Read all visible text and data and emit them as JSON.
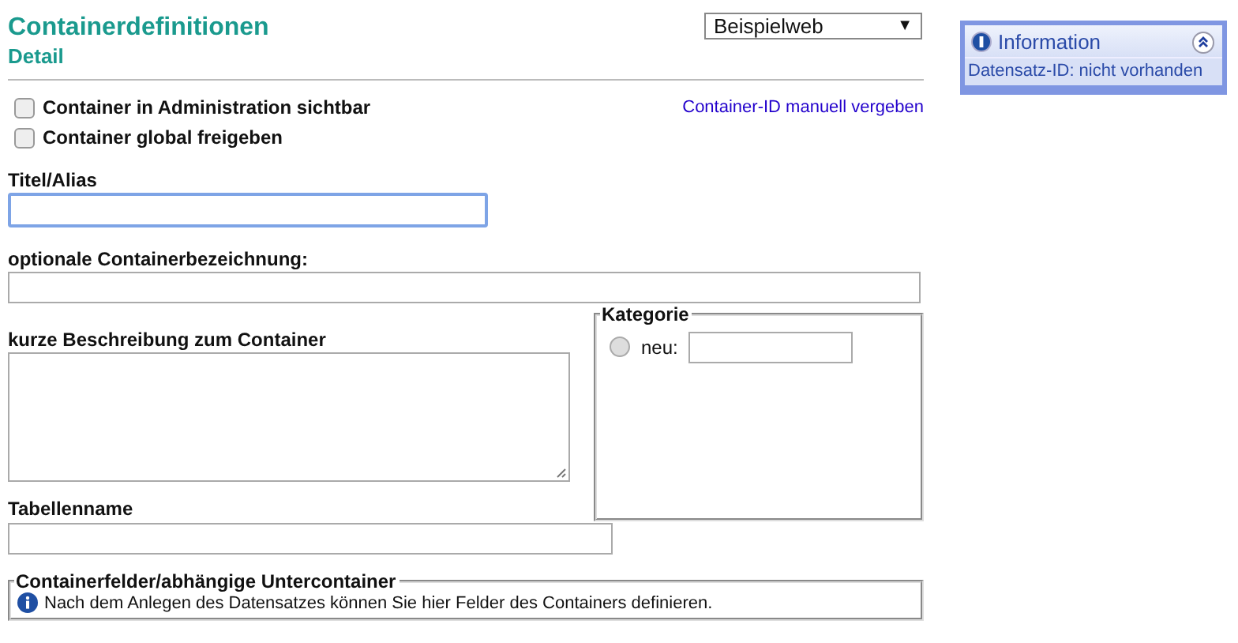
{
  "header": {
    "title": "Containerdefinitionen",
    "subtitle": "Detail"
  },
  "site_select": {
    "value": "Beispielweb",
    "arrow": "▼"
  },
  "options": [
    {
      "label": "Container in Administration sichtbar",
      "checked": false
    },
    {
      "label": "Container global freigeben",
      "checked": false
    }
  ],
  "manual_id_link": "Container-ID manuell vergeben",
  "fields": {
    "title_label": "Titel/Alias",
    "name_label": "optionale Containerbezeichnung:",
    "description_label": "kurze Beschreibung zum Container",
    "table_label": "Tabellenname"
  },
  "category": {
    "legend": "Kategorie",
    "options": [
      {
        "label": "neu:",
        "selected": false
      }
    ]
  },
  "subcontainers": {
    "legend": "Containerfelder/abhängige Untercontainer",
    "note": "Nach dem Anlegen des Datensatzes können Sie hier Felder des Containers definieren."
  },
  "info_panel": {
    "title": "Information",
    "expanded": true,
    "text": "Datensatz-ID: nicht vorhanden"
  }
}
